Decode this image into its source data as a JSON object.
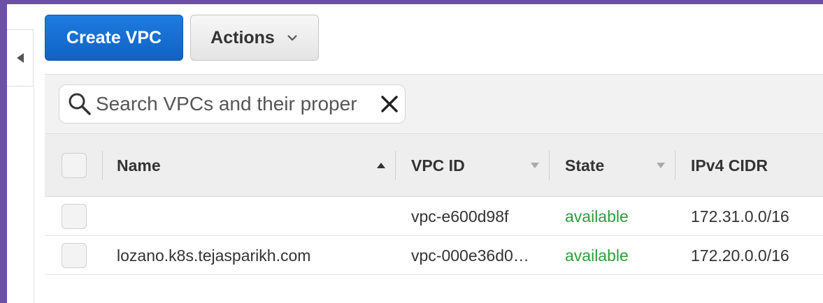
{
  "toolbar": {
    "create_label": "Create VPC",
    "actions_label": "Actions"
  },
  "search": {
    "placeholder": "Search VPCs and their proper"
  },
  "table": {
    "columns": [
      {
        "label": "Name",
        "sort": "ascending"
      },
      {
        "label": "VPC ID",
        "sort": "none"
      },
      {
        "label": "State",
        "sort": "none"
      },
      {
        "label": "IPv4 CIDR",
        "sort": "none"
      }
    ],
    "rows": [
      {
        "name": "",
        "vpc_id": "vpc-e600d98f",
        "state": "available",
        "cidr": "172.31.0.0/16"
      },
      {
        "name": "lozano.k8s.tejasparikh.com",
        "vpc_id": "vpc-000e36d0…",
        "state": "available",
        "cidr": "172.20.0.0/16"
      }
    ]
  },
  "colors": {
    "primary": "#1a72d6",
    "available": "#2e9d3b",
    "background": "#6b4fa8"
  },
  "icons": [
    "collapse-left-icon",
    "chevron-down-icon",
    "search-icon",
    "clear-icon",
    "sort-ascending-icon",
    "sort-descending-icon"
  ]
}
